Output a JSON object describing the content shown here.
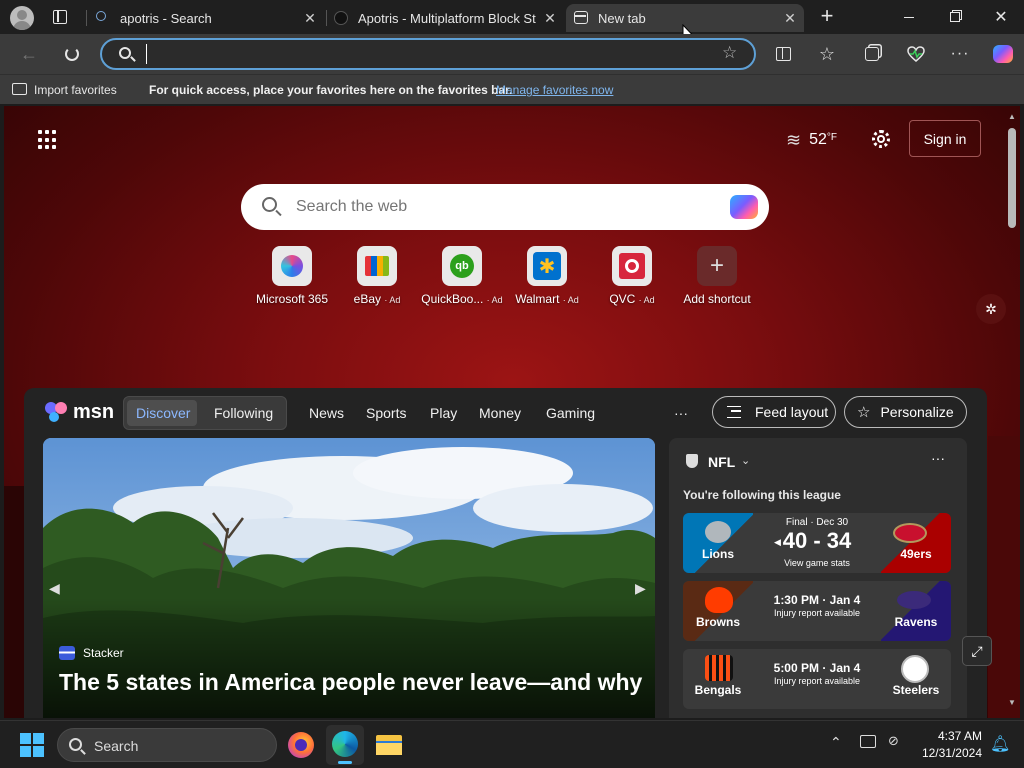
{
  "browser": {
    "tabs": [
      {
        "label": "apotris - Search",
        "active": false
      },
      {
        "label": "Apotris - Multiplatform Block Stac",
        "active": false
      },
      {
        "label": "New tab",
        "active": true
      }
    ],
    "address_value": "",
    "favorites_bar": {
      "import_label": "Import favorites",
      "message": "For quick access, place your favorites here on the favorites bar.",
      "manage_link": "Manage favorites now"
    }
  },
  "newtab": {
    "weather": {
      "temp": "52",
      "unit": "°F"
    },
    "signin_label": "Sign in",
    "search_placeholder": "Search the web",
    "shortcuts": [
      {
        "label": "Microsoft 365",
        "ad": ""
      },
      {
        "label": "eBay",
        "ad": "· Ad"
      },
      {
        "label": "QuickBoo...",
        "ad": "· Ad"
      },
      {
        "label": "Walmart",
        "ad": "· Ad"
      },
      {
        "label": "QVC",
        "ad": "· Ad"
      },
      {
        "label": "Add shortcut",
        "ad": ""
      }
    ]
  },
  "feed": {
    "brand": "msn",
    "tabs": [
      "Discover",
      "Following",
      "News",
      "Sports",
      "Play",
      "Money",
      "Gaming"
    ],
    "more": "···",
    "feed_layout_label": "Feed layout",
    "personalize_label": "Personalize",
    "hero": {
      "source": "Stacker",
      "headline": "The 5 states in America people never leave—and why"
    },
    "nfl": {
      "title": "NFL",
      "subtitle": "You're following this league",
      "games": [
        {
          "home": "Lions",
          "away": "49ers",
          "status": "Final · Dec 30",
          "score": "40 - 34",
          "note": "View game stats",
          "home_color": "#0076b6",
          "away_color": "#aa0000"
        },
        {
          "home": "Browns",
          "away": "Ravens",
          "status": "1:30 PM · Jan 4",
          "score": "",
          "note": "Injury report available",
          "home_color": "#ff3c00",
          "away_color": "#241773"
        },
        {
          "home": "Bengals",
          "away": "Steelers",
          "status": "5:00 PM · Jan 4",
          "score": "",
          "note": "Injury report available",
          "home_color": "#fb4f14",
          "away_color": "#101820"
        }
      ]
    }
  },
  "taskbar": {
    "search_label": "Search",
    "time": "4:37 AM",
    "date": "12/31/2024"
  }
}
